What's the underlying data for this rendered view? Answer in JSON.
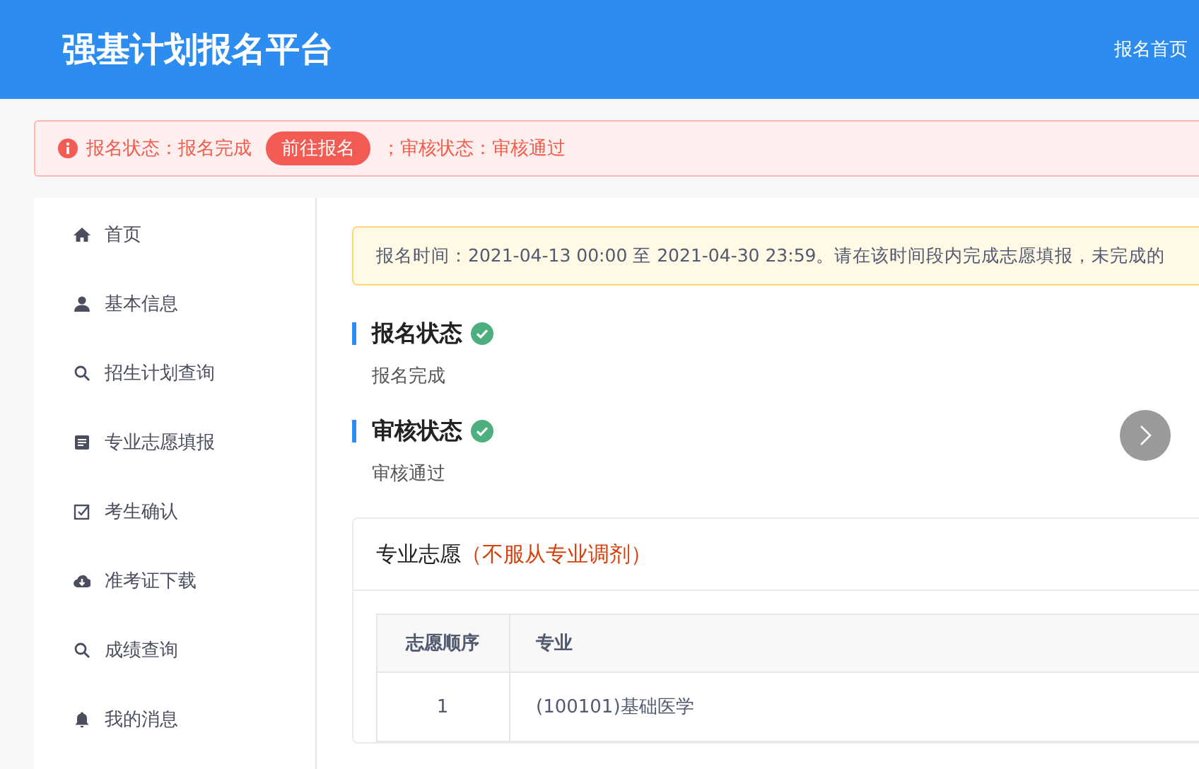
{
  "header": {
    "title": "强基计划报名平台",
    "nav": [
      "报名首页"
    ]
  },
  "alert": {
    "status_text": "报名状态：报名完成",
    "button": "前往报名",
    "review_text": "；审核状态：审核通过"
  },
  "sidebar": {
    "items": [
      {
        "label": "首页"
      },
      {
        "label": "基本信息"
      },
      {
        "label": "招生计划查询"
      },
      {
        "label": "专业志愿填报"
      },
      {
        "label": "考生确认"
      },
      {
        "label": "准考证下载"
      },
      {
        "label": "成绩查询"
      },
      {
        "label": "我的消息"
      }
    ]
  },
  "notice": "报名时间：2021-04-13 00:00 至 2021-04-30 23:59。请在该时间段内完成志愿填报，未完成的",
  "statuses": [
    {
      "title": "报名状态",
      "done": true,
      "value": "报名完成"
    },
    {
      "title": "审核状态",
      "done": true,
      "value": "审核通过"
    }
  ],
  "preferences": {
    "title": "专业志愿",
    "note": "（不服从专业调剂）",
    "table": {
      "columns": [
        "志愿顺序",
        "专业"
      ],
      "rows": [
        [
          "1",
          "(100101)基础医学"
        ]
      ]
    }
  }
}
